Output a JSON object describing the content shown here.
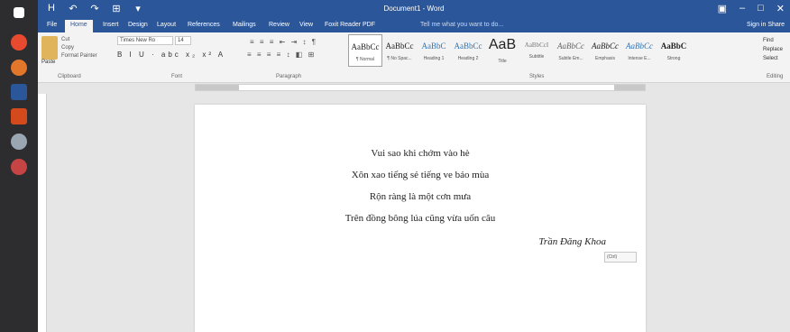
{
  "window": {
    "title": "Document1 - Word",
    "quick_access": [
      "H",
      "↶",
      "↷",
      "⊞",
      "▾"
    ],
    "controls": [
      "▣",
      "–",
      "□",
      "✕"
    ]
  },
  "tabs": [
    "File",
    "Home",
    "Insert",
    "Design",
    "Layout",
    "References",
    "Mailings",
    "Review",
    "View",
    "Foxit Reader PDF"
  ],
  "tell_me": "Tell me what you want to do...",
  "sign_in": "Sign in",
  "share": "Share",
  "ribbon": {
    "clipboard": {
      "paste": "Paste",
      "cut": "Cut",
      "copy": "Copy",
      "format_painter": "Format Painter",
      "label": "Clipboard"
    },
    "font": {
      "family": "Times New Ro",
      "size": "14",
      "row2": "B I U · abc x₂ x² A",
      "label": "Font"
    },
    "paragraph": {
      "row1": "≡ ≡ ≡ ⇤ ⇥ ↕ ¶",
      "row2": "≡ ≡ ≡ ≡ ↕ ◧ ⊞",
      "label": "Paragraph"
    },
    "styles": [
      {
        "sample": "AaBbCc",
        "name": "¶ Normal"
      },
      {
        "sample": "AaBbCc",
        "name": "¶ No Spac..."
      },
      {
        "sample": "AaBbC",
        "name": "Heading 1"
      },
      {
        "sample": "AaBbCc",
        "name": "Heading 2"
      },
      {
        "sample": "AaB",
        "name": "Title"
      },
      {
        "sample": "AaBbCcI",
        "name": "Subtitle"
      },
      {
        "sample": "AaBbCc",
        "name": "Subtle Em..."
      },
      {
        "sample": "AaBbCc",
        "name": "Emphasis"
      },
      {
        "sample": "AaBbCc",
        "name": "Intense E..."
      },
      {
        "sample": "AaBbC",
        "name": "Strong"
      }
    ],
    "styles_label": "Styles",
    "editing": {
      "find": "Find",
      "replace": "Replace",
      "select": "Select",
      "label": "Editing"
    }
  },
  "document": {
    "lines": [
      "Vui sao khi chớm vào hè",
      "Xôn xao tiếng sẻ tiếng ve báo mùa",
      "Rộn ràng là một cơn mưa",
      "Trên đồng bông lúa cũng vừa uốn câu"
    ],
    "author": "Trần Đăng Khoa",
    "paste_options": "(Ctrl)"
  }
}
